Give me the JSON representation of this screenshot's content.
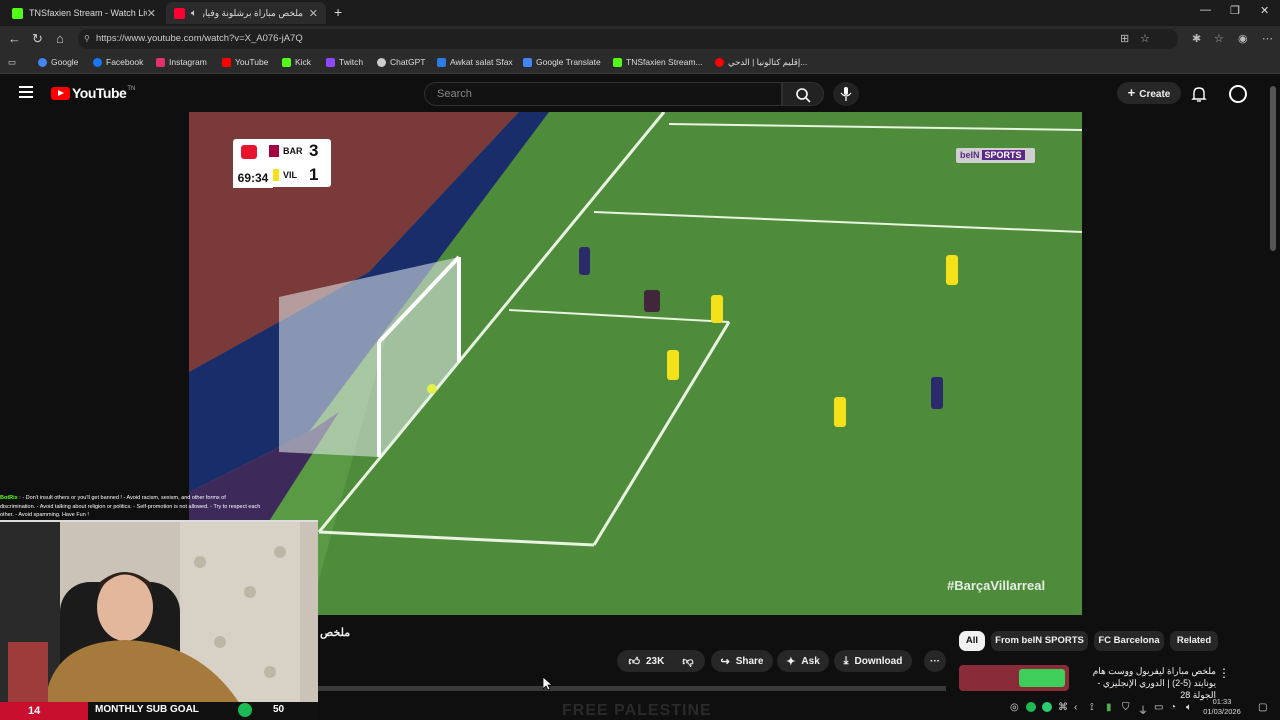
{
  "browser": {
    "tabs": [
      {
        "title": "TNSfaxien Stream - Watch Live on",
        "favicon_color": "#53fc18"
      },
      {
        "title": "ملخص مباراة برشلونة وفياريال",
        "favicon_color": "#ff0033"
      }
    ],
    "new_tab_symbol": "+",
    "url": "https://www.youtube.com/watch?v=X_A076-jA7Q",
    "bookmarks": [
      {
        "label": "Google",
        "color": "#4285f4"
      },
      {
        "label": "Facebook",
        "color": "#1877f2"
      },
      {
        "label": "Instagram",
        "color": "#e1306c"
      },
      {
        "label": "YouTube",
        "color": "#ff0000"
      },
      {
        "label": "Kick",
        "color": "#53fc18"
      },
      {
        "label": "Twitch",
        "color": "#9146ff"
      },
      {
        "label": "ChatGPT",
        "color": "#cccccc"
      },
      {
        "label": "Awkat salat Sfax",
        "color": "#2b7de9"
      },
      {
        "label": "Google Translate",
        "color": "#4285f4"
      },
      {
        "label": "TNSfaxien Stream...",
        "color": "#53fc18"
      },
      {
        "label": "إقليم كتالونيا | الدحي...",
        "color": "#ff0000"
      }
    ]
  },
  "youtube": {
    "logo_text": "YouTube",
    "logo_country": "TN",
    "search_placeholder": "Search",
    "create_label": "Create"
  },
  "video": {
    "scoreboard": {
      "time": "69:34",
      "home_team": "BAR",
      "home_score": "3",
      "away_team": "VIL",
      "away_score": "1"
    },
    "broadcaster_brand": "beIN",
    "broadcaster_suffix": "SPORTS",
    "hashtag": "#BarçaVillarreal",
    "title": "ملخص"
  },
  "actions": {
    "like_count": "23K",
    "share_label": "Share",
    "ask_label": "Ask",
    "download_label": "Download",
    "more_symbol": "···"
  },
  "chips": [
    {
      "label": "All",
      "active": true
    },
    {
      "label": "From beIN SPORTS",
      "active": false
    },
    {
      "label": "FC Barcelona",
      "active": false
    },
    {
      "label": "Related",
      "active": false
    }
  ],
  "recommended": {
    "title": "ملخص مباراة ليفربول ووست هام يونايتد (5-2) | الدوري الإنجليزي - الجولة 28"
  },
  "stream_overlay": {
    "chat_bot_name": "BotRix",
    "chat_message": ": - Don't insult others or you'll get banned ! - Avoid racism, sexism, and other forms of discrimination. - Avoid talking about religion or politics. - Self-promotion is not allowed. - Try to respect each other. - Avoid spamming. Have Fun !",
    "goal_current": "14",
    "goal_label": "MONTHLY SUB GOAL",
    "goal_target": "50",
    "banner_text": "FREE PALESTINE"
  },
  "taskbar": {
    "time": "01:33",
    "date": "01/03/2026"
  }
}
